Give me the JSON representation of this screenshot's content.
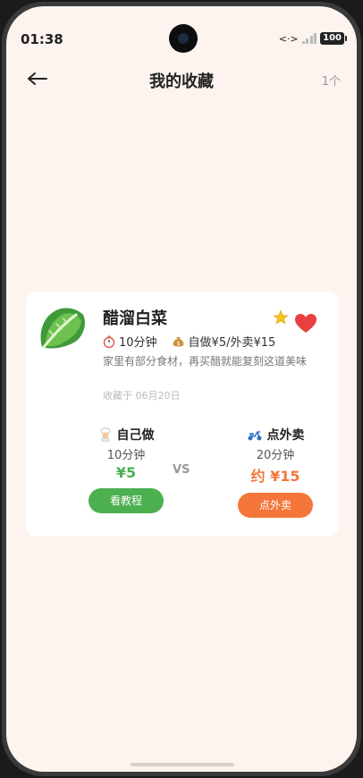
{
  "status_bar": {
    "time": "01:38",
    "network_icon": "<·>",
    "battery": "100"
  },
  "header": {
    "back_icon": "arrow-left-icon",
    "title": "我的收藏",
    "count": "1个"
  },
  "favorites": [
    {
      "icon": "lettuce-icon",
      "name": "醋溜白菜",
      "time": "10分钟",
      "cost": "自做¥5/外卖¥15",
      "description": "家里有部分食材，再买醋就能复刻这道美味",
      "saved_date": "收藏于 06月20日",
      "vs_label": "VS",
      "self_cook": {
        "label": "自己做",
        "time": "10分钟",
        "price": "¥5",
        "button": "看教程"
      },
      "takeout": {
        "label": "点外卖",
        "time": "20分钟",
        "price": "约 ¥15",
        "button": "点外卖"
      }
    }
  ],
  "colors": {
    "background": "#fdf3ef",
    "green": "#4caf50",
    "orange": "#f4763a",
    "heart": "#e8403f"
  }
}
